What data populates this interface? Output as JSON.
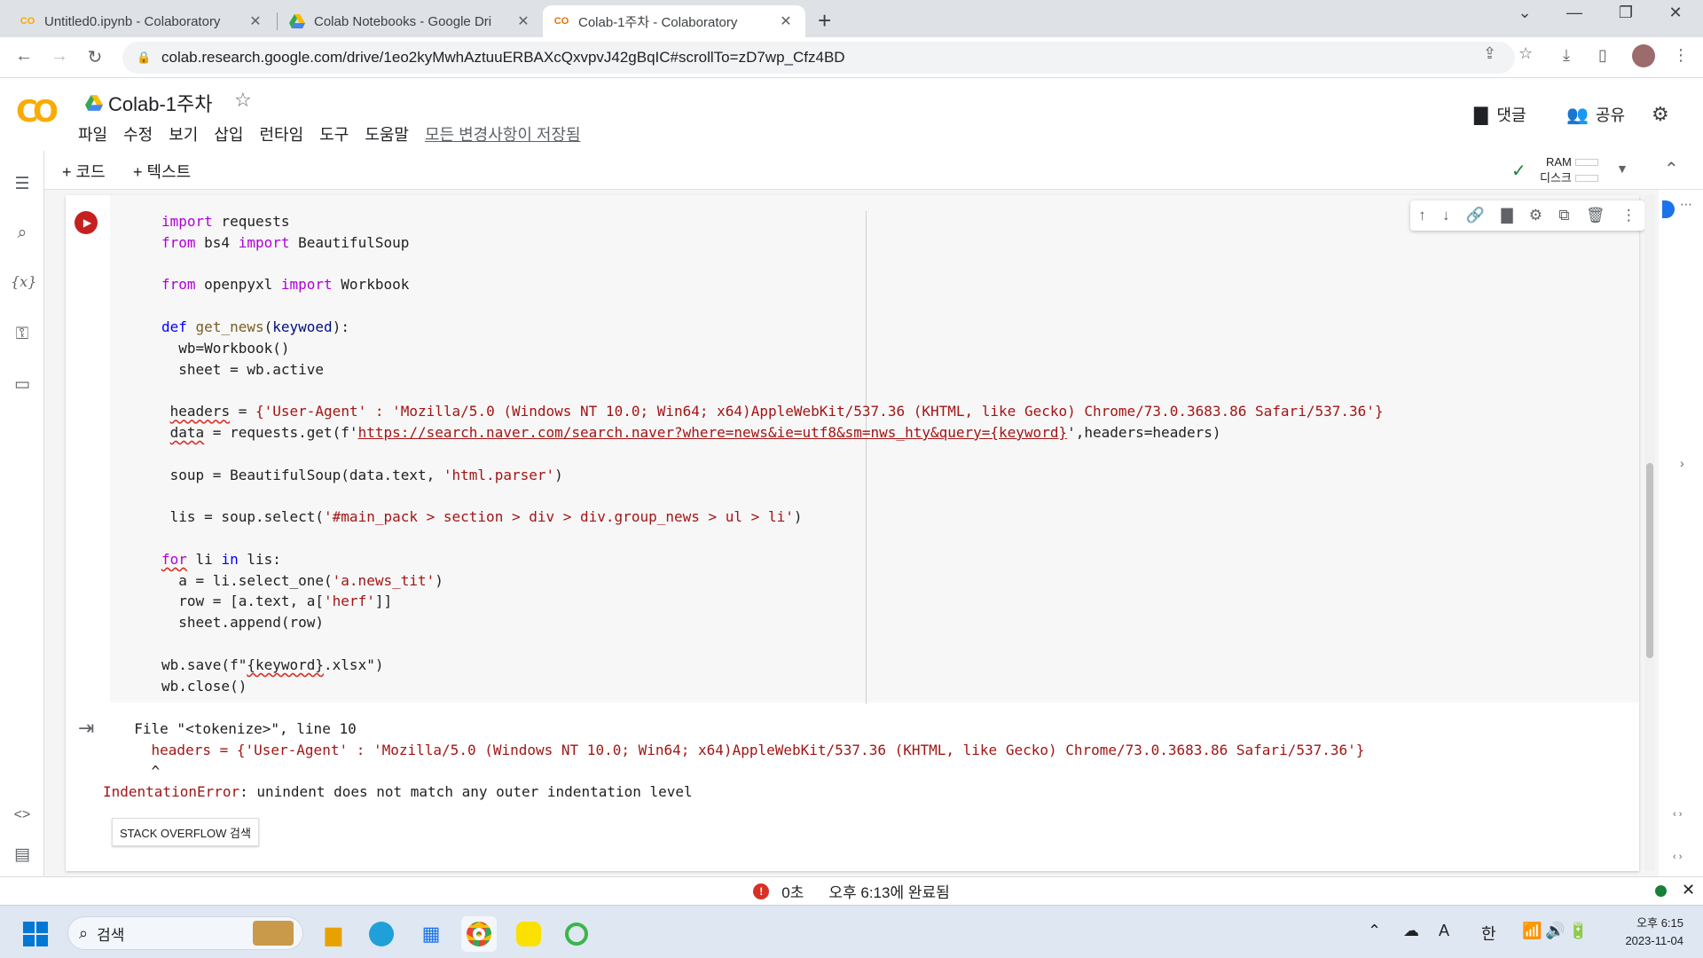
{
  "browser": {
    "tabs": [
      {
        "title": "Untitled0.ipynb - Colaboratory",
        "favicon": "CO"
      },
      {
        "title": "Colab Notebooks - Google Dri",
        "favicon": "drive"
      },
      {
        "title": "Colab-1주차 - Colaboratory",
        "favicon": "CO"
      }
    ],
    "active_tab": 2,
    "url": "colab.research.google.com/drive/1eo2kyMwhAztuuERBAXcQxvpvJ42gBqIC#scrollTo=zD7wp_Cfz4BD"
  },
  "colab": {
    "logo": "CO",
    "title": "Colab-1주차",
    "menu": [
      "파일",
      "수정",
      "보기",
      "삽입",
      "런타임",
      "도구",
      "도움말"
    ],
    "saved_status": "모든 변경사항이 저장됨",
    "comments_label": "댓글",
    "share_label": "공유",
    "add_code_label": "+ 코드",
    "add_text_label": "+ 텍스트",
    "ram_label": "RAM",
    "disk_label": "디스크"
  },
  "code_lines": {
    "l1_kw": "import",
    "l1_rest": " requests",
    "l2_kw1": "from",
    "l2_mid": " bs4 ",
    "l2_kw2": "import",
    "l2_rest": " BeautifulSoup",
    "l4_kw1": "from",
    "l4_mid": " openpyxl ",
    "l4_kw2": "import",
    "l4_rest": " Workbook",
    "l6_kw": "def",
    "l6_fn": "get_news",
    "l6_param": "keywoed",
    "l7": "  wb=Workbook()",
    "l8": "  sheet = wb.active",
    "l10_var": "headers",
    "l10_str": "{'User-Agent' : 'Mozilla/5.0 (Windows NT 10.0; Win64; x64)AppleWebKit/537.36 (KHTML, like Gecko) Chrome/73.0.3683.86 Safari/537.36'}",
    "l11_var": "data",
    "l11_pre": " = requests.get(f'",
    "l11_url": "https://search.naver.com/search.naver?where=news&ie=utf8&sm=nws_hty&query={keyword}",
    "l11_post": "',headers=headers)",
    "l13_pre": " soup = BeautifulSoup(data.text, ",
    "l13_str": "'html.parser'",
    "l15_pre": " lis = soup.select(",
    "l15_str": "'#main_pack > section > div > div.group_news > ul > li'",
    "l17_kw": "for",
    "l17_mid": " li ",
    "l17_kw2": "in",
    "l17_rest": " lis:",
    "l18_pre": "  a = li.select_one(",
    "l18_str": "'a.news_tit'",
    "l19_pre": "  row = [a.text, a[",
    "l19_str": "'herf'",
    "l20": "  sheet.append(row)",
    "l22_pre": "wb.save(f\"",
    "l22_var": "{keyword}",
    "l22_post": ".xlsx\")",
    "l23": "wb.close()"
  },
  "output": {
    "line1": "  File \"<tokenize>\", line 10",
    "line2": "    headers = {'User-Agent' : 'Mozilla/5.0 (Windows NT 10.0; Win64; x64)AppleWebKit/537.36 (KHTML, like Gecko) Chrome/73.0.3683.86 Safari/537.36'}",
    "line3": "    ^",
    "error_name": "IndentationError",
    "error_msg": ": unindent does not match any outer indentation level",
    "stackoverflow_label": "STACK OVERFLOW 검색"
  },
  "status": {
    "duration": "0초",
    "completed": "오후 6:13에 완료됨"
  },
  "taskbar": {
    "search_label": "검색",
    "ime_letter": "A",
    "ime_lang": "한",
    "time": "오후 6:15",
    "date": "2023-11-04"
  }
}
